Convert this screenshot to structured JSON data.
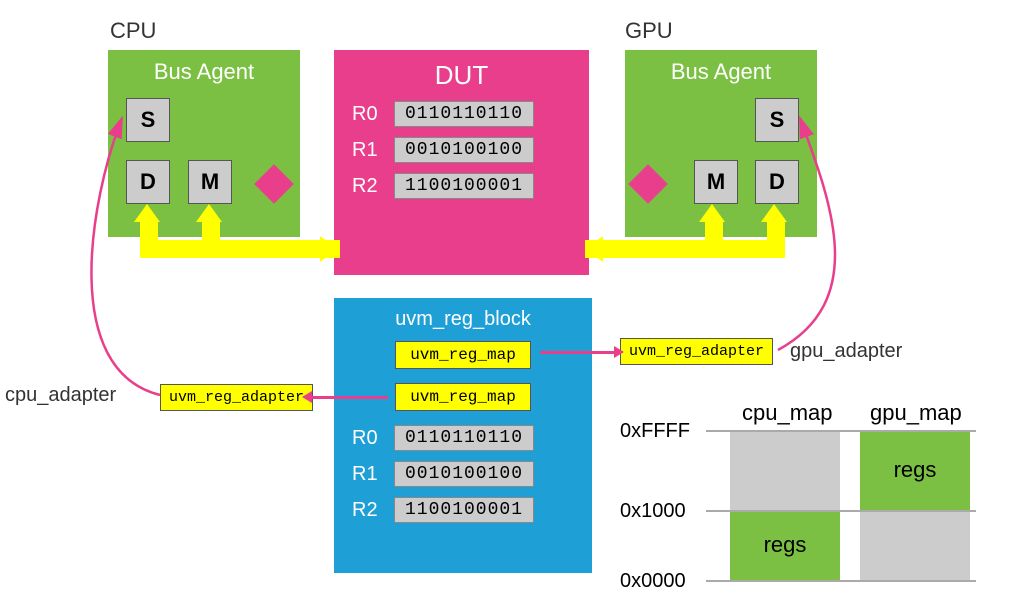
{
  "cpu": {
    "label": "CPU",
    "agent_title": "Bus Agent",
    "S": "S",
    "D": "D",
    "M": "M"
  },
  "gpu": {
    "label": "GPU",
    "agent_title": "Bus Agent",
    "S": "S",
    "D": "D",
    "M": "M"
  },
  "dut": {
    "title": "DUT",
    "regs": [
      {
        "name": "R0",
        "val": "0110110110"
      },
      {
        "name": "R1",
        "val": "0010100100"
      },
      {
        "name": "R2",
        "val": "1100100001"
      }
    ]
  },
  "reg_block": {
    "title": "uvm_reg_block",
    "map1": "uvm_reg_map",
    "map2": "uvm_reg_map",
    "regs": [
      {
        "name": "R0",
        "val": "0110110110"
      },
      {
        "name": "R1",
        "val": "0010100100"
      },
      {
        "name": "R2",
        "val": "1100100001"
      }
    ]
  },
  "adapters": {
    "cpu_box": "uvm_reg_adapter",
    "gpu_box": "uvm_reg_adapter",
    "cpu_label": "cpu_adapter",
    "gpu_label": "gpu_adapter"
  },
  "mem_map": {
    "addr_top": "0xFFFF",
    "addr_mid": "0x1000",
    "addr_bot": "0x0000",
    "col1_hdr": "cpu_map",
    "col2_hdr": "gpu_map",
    "cpu_regs_label": "regs",
    "gpu_regs_label": "regs"
  }
}
